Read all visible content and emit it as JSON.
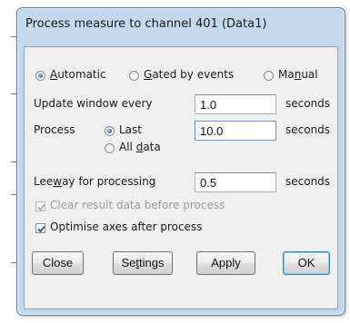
{
  "window": {
    "title": "Process measure to channel 401 (Data1)"
  },
  "mode": {
    "automatic_label": "Automatic",
    "gated_label": "Gated by events",
    "manual_label": "Manual"
  },
  "update": {
    "label": "Update window every",
    "value": "1.0",
    "unit": "seconds"
  },
  "process": {
    "label": "Process",
    "last_label": "Last",
    "all_data_label": "All data",
    "value": "10.0",
    "unit": "seconds"
  },
  "leeway": {
    "label": "Leeway for processing",
    "value": "0.5",
    "unit": "seconds"
  },
  "options": {
    "clear_label": "Clear result data before process",
    "optimise_label": "Optimise axes after process"
  },
  "buttons": {
    "close": "Close",
    "settings": "Settings",
    "apply": "Apply",
    "ok": "OK"
  }
}
